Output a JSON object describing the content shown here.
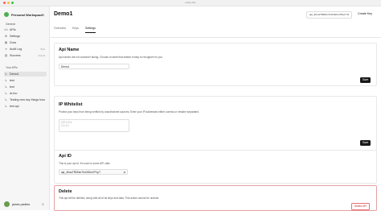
{
  "window": {
    "url": "unkey.dev",
    "dots": [
      "#ff5f57",
      "#febc2e",
      "#28c840"
    ]
  },
  "sidebar": {
    "workspace": "Personal Workspace",
    "general_label": "General",
    "items": [
      {
        "label": "APIs",
        "icon": "code-icon"
      },
      {
        "label": "Settings",
        "icon": "gear-icon"
      },
      {
        "label": "Docs",
        "icon": "book-icon"
      },
      {
        "label": "Audit Log",
        "icon": "list-icon",
        "badge": "Beta"
      },
      {
        "label": "Success",
        "icon": "chart-icon",
        "badge": "Internal"
      }
    ],
    "apis_label": "Your APIs",
    "apis": [
      {
        "label": "Demo1",
        "active": true
      },
      {
        "label": "test"
      },
      {
        "label": "test"
      },
      {
        "label": "dr-foo"
      },
      {
        "label": "Testing new key things hour"
      },
      {
        "label": "test api"
      }
    ],
    "user": "james parkins"
  },
  "header": {
    "title": "Demo1",
    "api_id": "api_4KcwTRDNm7Hz3Gbm7PLpT",
    "create_key": "Create Key"
  },
  "tabs": [
    {
      "label": "Overview",
      "active": false
    },
    {
      "label": "Keys",
      "active": false
    },
    {
      "label": "Settings",
      "active": true
    }
  ],
  "api_name_card": {
    "title": "Api Name",
    "description": "Api names are not customer facing. Choose a name that makes it easy to recognize for you.",
    "value": "Demo1",
    "save": "Save"
  },
  "ip_whitelist_card": {
    "title": "IP Whitelist",
    "description": "Protect your keys from being verified by unauthorized sources. Enter your IP addresses either comma or newline separated.",
    "placeholder": "127.0.0.1\n1.1.1.1",
    "save": "Save"
  },
  "api_id_card": {
    "title": "Api ID",
    "description": "This is your api id. It's used in some API calls.",
    "value": "api_4KcwTRDNm7Hz3Gbm7PLpT"
  },
  "delete_card": {
    "title": "Delete",
    "description": "This api will be deleted, along with all of its keys and data. This action cannot be undone.",
    "button": "Delete API"
  }
}
